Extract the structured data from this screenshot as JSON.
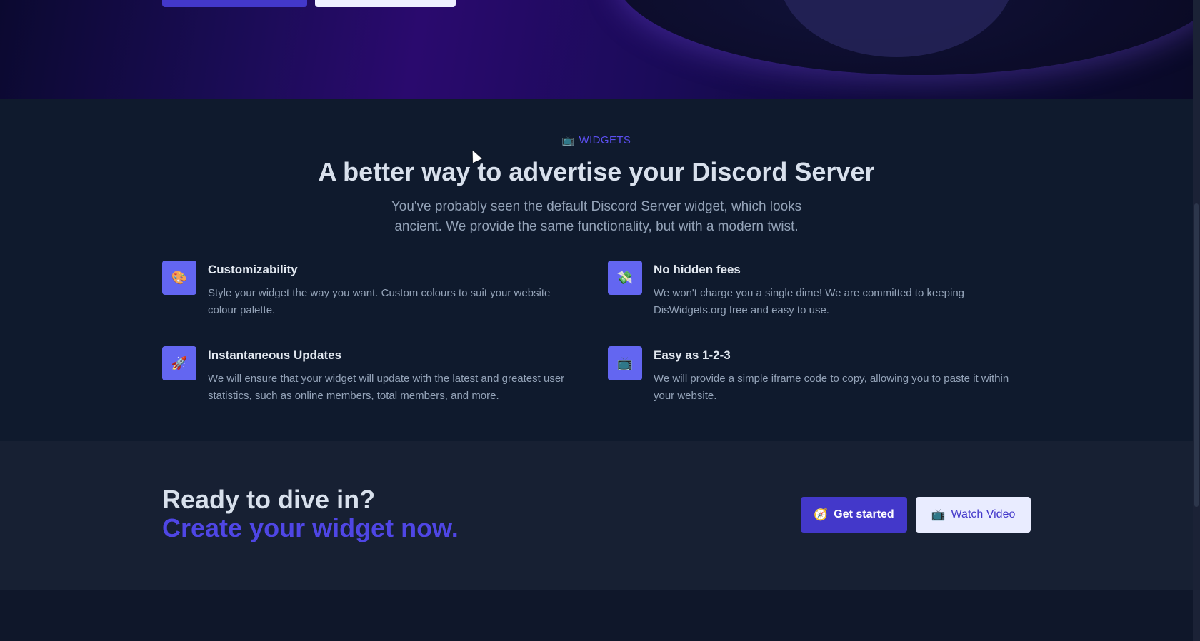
{
  "hero": {
    "primary_button_label": "",
    "secondary_button_label": ""
  },
  "features": {
    "eyebrow": "WIDGETS",
    "eyebrow_icon": "tv-icon",
    "heading": "A better way to advertise your Discord Server",
    "lead": "You've probably seen the default Discord Server widget, which looks ancient. We provide the same functionality, but with a modern twist.",
    "items": [
      {
        "icon": "palette-icon",
        "title": "Customizability",
        "description": "Style your widget the way you want. Custom colours to suit your website colour palette."
      },
      {
        "icon": "no-money-icon",
        "title": "No hidden fees",
        "description": "We won't charge you a single dime! We are committed to keeping DisWidgets.org free and easy to use."
      },
      {
        "icon": "rocket-icon",
        "title": "Instantaneous Updates",
        "description": "We will ensure that your widget will update with the latest and greatest user statistics, such as online members, total members, and more."
      },
      {
        "icon": "tv-icon",
        "title": "Easy as 1-2-3",
        "description": "We will provide a simple iframe code to copy, allowing you to paste it within your website."
      }
    ]
  },
  "cta": {
    "title": "Ready to dive in?",
    "subtitle": "Create your widget now.",
    "primary_button_label": "Get started",
    "primary_button_icon": "compass-icon",
    "secondary_button_label": "Watch Video",
    "secondary_button_icon": "tv-icon"
  },
  "colors": {
    "accent": "#4f46e5",
    "icon_box": "#6366f1",
    "background": "#0f1a2d"
  }
}
